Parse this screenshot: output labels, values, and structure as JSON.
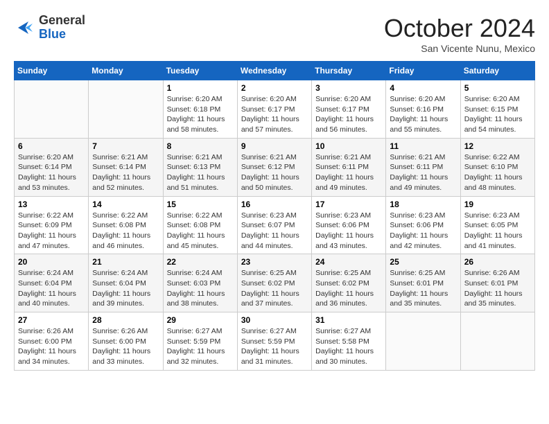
{
  "logo": {
    "general": "General",
    "blue": "Blue"
  },
  "title": "October 2024",
  "location": "San Vicente Nunu, Mexico",
  "days_header": [
    "Sunday",
    "Monday",
    "Tuesday",
    "Wednesday",
    "Thursday",
    "Friday",
    "Saturday"
  ],
  "weeks": [
    [
      {
        "day": "",
        "info": ""
      },
      {
        "day": "",
        "info": ""
      },
      {
        "day": "1",
        "info": "Sunrise: 6:20 AM\nSunset: 6:18 PM\nDaylight: 11 hours and 58 minutes."
      },
      {
        "day": "2",
        "info": "Sunrise: 6:20 AM\nSunset: 6:17 PM\nDaylight: 11 hours and 57 minutes."
      },
      {
        "day": "3",
        "info": "Sunrise: 6:20 AM\nSunset: 6:17 PM\nDaylight: 11 hours and 56 minutes."
      },
      {
        "day": "4",
        "info": "Sunrise: 6:20 AM\nSunset: 6:16 PM\nDaylight: 11 hours and 55 minutes."
      },
      {
        "day": "5",
        "info": "Sunrise: 6:20 AM\nSunset: 6:15 PM\nDaylight: 11 hours and 54 minutes."
      }
    ],
    [
      {
        "day": "6",
        "info": "Sunrise: 6:20 AM\nSunset: 6:14 PM\nDaylight: 11 hours and 53 minutes."
      },
      {
        "day": "7",
        "info": "Sunrise: 6:21 AM\nSunset: 6:14 PM\nDaylight: 11 hours and 52 minutes."
      },
      {
        "day": "8",
        "info": "Sunrise: 6:21 AM\nSunset: 6:13 PM\nDaylight: 11 hours and 51 minutes."
      },
      {
        "day": "9",
        "info": "Sunrise: 6:21 AM\nSunset: 6:12 PM\nDaylight: 11 hours and 50 minutes."
      },
      {
        "day": "10",
        "info": "Sunrise: 6:21 AM\nSunset: 6:11 PM\nDaylight: 11 hours and 49 minutes."
      },
      {
        "day": "11",
        "info": "Sunrise: 6:21 AM\nSunset: 6:11 PM\nDaylight: 11 hours and 49 minutes."
      },
      {
        "day": "12",
        "info": "Sunrise: 6:22 AM\nSunset: 6:10 PM\nDaylight: 11 hours and 48 minutes."
      }
    ],
    [
      {
        "day": "13",
        "info": "Sunrise: 6:22 AM\nSunset: 6:09 PM\nDaylight: 11 hours and 47 minutes."
      },
      {
        "day": "14",
        "info": "Sunrise: 6:22 AM\nSunset: 6:08 PM\nDaylight: 11 hours and 46 minutes."
      },
      {
        "day": "15",
        "info": "Sunrise: 6:22 AM\nSunset: 6:08 PM\nDaylight: 11 hours and 45 minutes."
      },
      {
        "day": "16",
        "info": "Sunrise: 6:23 AM\nSunset: 6:07 PM\nDaylight: 11 hours and 44 minutes."
      },
      {
        "day": "17",
        "info": "Sunrise: 6:23 AM\nSunset: 6:06 PM\nDaylight: 11 hours and 43 minutes."
      },
      {
        "day": "18",
        "info": "Sunrise: 6:23 AM\nSunset: 6:06 PM\nDaylight: 11 hours and 42 minutes."
      },
      {
        "day": "19",
        "info": "Sunrise: 6:23 AM\nSunset: 6:05 PM\nDaylight: 11 hours and 41 minutes."
      }
    ],
    [
      {
        "day": "20",
        "info": "Sunrise: 6:24 AM\nSunset: 6:04 PM\nDaylight: 11 hours and 40 minutes."
      },
      {
        "day": "21",
        "info": "Sunrise: 6:24 AM\nSunset: 6:04 PM\nDaylight: 11 hours and 39 minutes."
      },
      {
        "day": "22",
        "info": "Sunrise: 6:24 AM\nSunset: 6:03 PM\nDaylight: 11 hours and 38 minutes."
      },
      {
        "day": "23",
        "info": "Sunrise: 6:25 AM\nSunset: 6:02 PM\nDaylight: 11 hours and 37 minutes."
      },
      {
        "day": "24",
        "info": "Sunrise: 6:25 AM\nSunset: 6:02 PM\nDaylight: 11 hours and 36 minutes."
      },
      {
        "day": "25",
        "info": "Sunrise: 6:25 AM\nSunset: 6:01 PM\nDaylight: 11 hours and 35 minutes."
      },
      {
        "day": "26",
        "info": "Sunrise: 6:26 AM\nSunset: 6:01 PM\nDaylight: 11 hours and 35 minutes."
      }
    ],
    [
      {
        "day": "27",
        "info": "Sunrise: 6:26 AM\nSunset: 6:00 PM\nDaylight: 11 hours and 34 minutes."
      },
      {
        "day": "28",
        "info": "Sunrise: 6:26 AM\nSunset: 6:00 PM\nDaylight: 11 hours and 33 minutes."
      },
      {
        "day": "29",
        "info": "Sunrise: 6:27 AM\nSunset: 5:59 PM\nDaylight: 11 hours and 32 minutes."
      },
      {
        "day": "30",
        "info": "Sunrise: 6:27 AM\nSunset: 5:59 PM\nDaylight: 11 hours and 31 minutes."
      },
      {
        "day": "31",
        "info": "Sunrise: 6:27 AM\nSunset: 5:58 PM\nDaylight: 11 hours and 30 minutes."
      },
      {
        "day": "",
        "info": ""
      },
      {
        "day": "",
        "info": ""
      }
    ]
  ]
}
